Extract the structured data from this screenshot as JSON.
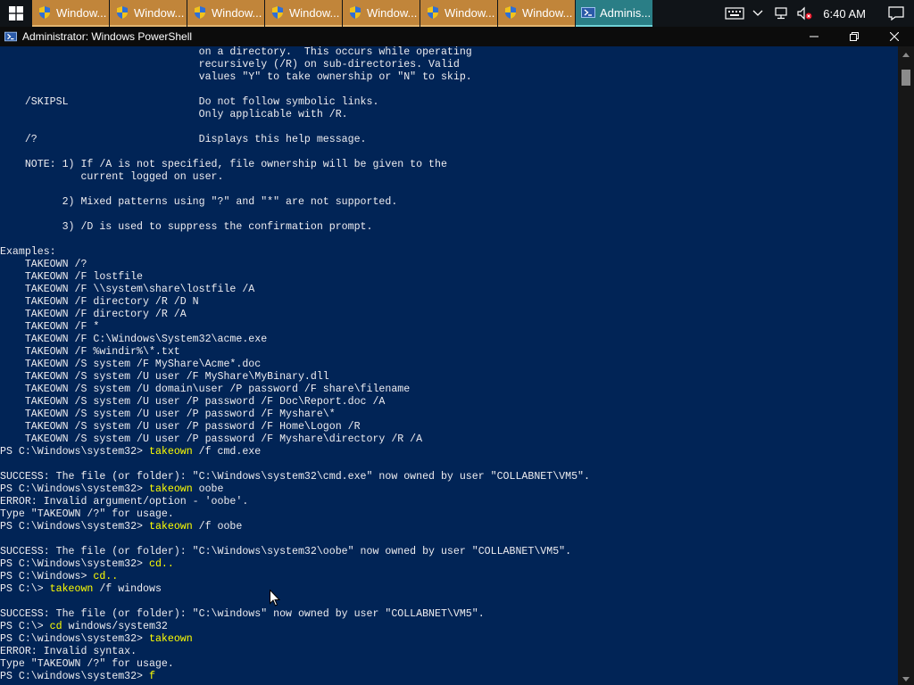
{
  "taskbar": {
    "tasks": [
      {
        "label": "Window..."
      },
      {
        "label": "Window..."
      },
      {
        "label": "Window..."
      },
      {
        "label": "Window..."
      },
      {
        "label": "Window..."
      },
      {
        "label": "Window..."
      },
      {
        "label": "Window..."
      },
      {
        "label": "Adminis..."
      }
    ],
    "clock": "6:40 AM",
    "colors": {
      "task_bg": "#c1853a",
      "active_task_bg": "#2a7e86",
      "taskbar_bg": "#101418"
    }
  },
  "window": {
    "title": "Administrator: Windows PowerShell",
    "colors": {
      "console_bg": "#012456",
      "text": "#eeedf0",
      "command": "#ffff00"
    }
  },
  "console": {
    "lines": [
      {
        "text": "                                on a directory.  This occurs while operating"
      },
      {
        "text": "                                recursively (/R) on sub-directories. Valid"
      },
      {
        "text": "                                values \"Y\" to take ownership or \"N\" to skip."
      },
      {
        "text": ""
      },
      {
        "text": "    /SKIPSL                     Do not follow symbolic links."
      },
      {
        "text": "                                Only applicable with /R."
      },
      {
        "text": ""
      },
      {
        "text": "    /?                          Displays this help message."
      },
      {
        "text": ""
      },
      {
        "text": "    NOTE: 1) If /A is not specified, file ownership will be given to the"
      },
      {
        "text": "             current logged on user."
      },
      {
        "text": ""
      },
      {
        "text": "          2) Mixed patterns using \"?\" and \"*\" are not supported."
      },
      {
        "text": ""
      },
      {
        "text": "          3) /D is used to suppress the confirmation prompt."
      },
      {
        "text": ""
      },
      {
        "text": "Examples:"
      },
      {
        "text": "    TAKEOWN /?"
      },
      {
        "text": "    TAKEOWN /F lostfile"
      },
      {
        "text": "    TAKEOWN /F \\\\system\\share\\lostfile /A"
      },
      {
        "text": "    TAKEOWN /F directory /R /D N"
      },
      {
        "text": "    TAKEOWN /F directory /R /A"
      },
      {
        "text": "    TAKEOWN /F *"
      },
      {
        "text": "    TAKEOWN /F C:\\Windows\\System32\\acme.exe"
      },
      {
        "text": "    TAKEOWN /F %windir%\\*.txt"
      },
      {
        "text": "    TAKEOWN /S system /F MyShare\\Acme*.doc"
      },
      {
        "text": "    TAKEOWN /S system /U user /F MyShare\\MyBinary.dll"
      },
      {
        "text": "    TAKEOWN /S system /U domain\\user /P password /F share\\filename"
      },
      {
        "text": "    TAKEOWN /S system /U user /P password /F Doc\\Report.doc /A"
      },
      {
        "text": "    TAKEOWN /S system /U user /P password /F Myshare\\*"
      },
      {
        "text": "    TAKEOWN /S system /U user /P password /F Home\\Logon /R"
      },
      {
        "text": "    TAKEOWN /S system /U user /P password /F Myshare\\directory /R /A"
      },
      {
        "prompt": "PS C:\\Windows\\system32> ",
        "cmd": "takeown",
        "args": " /f cmd.exe"
      },
      {
        "text": ""
      },
      {
        "text": "SUCCESS: The file (or folder): \"C:\\Windows\\system32\\cmd.exe\" now owned by user \"COLLABNET\\VM5\"."
      },
      {
        "prompt": "PS C:\\Windows\\system32> ",
        "cmd": "takeown",
        "args": " oobe"
      },
      {
        "text": "ERROR: Invalid argument/option - 'oobe'."
      },
      {
        "text": "Type \"TAKEOWN /?\" for usage."
      },
      {
        "prompt": "PS C:\\Windows\\system32> ",
        "cmd": "takeown",
        "args": " /f oobe"
      },
      {
        "text": ""
      },
      {
        "text": "SUCCESS: The file (or folder): \"C:\\Windows\\system32\\oobe\" now owned by user \"COLLABNET\\VM5\"."
      },
      {
        "prompt": "PS C:\\Windows\\system32> ",
        "cmd": "cd..",
        "args": ""
      },
      {
        "prompt": "PS C:\\Windows> ",
        "cmd": "cd..",
        "args": ""
      },
      {
        "prompt": "PS C:\\> ",
        "cmd": "takeown",
        "args": " /f windows"
      },
      {
        "text": ""
      },
      {
        "text": "SUCCESS: The file (or folder): \"C:\\windows\" now owned by user \"COLLABNET\\VM5\"."
      },
      {
        "prompt": "PS C:\\> ",
        "cmd": "cd",
        "args": " windows/system32"
      },
      {
        "prompt": "PS C:\\windows\\system32> ",
        "cmd": "takeown",
        "args": ""
      },
      {
        "text": "ERROR: Invalid syntax."
      },
      {
        "text": "Type \"TAKEOWN /?\" for usage."
      },
      {
        "prompt": "PS C:\\windows\\system32> ",
        "cmd": "f",
        "args": ""
      }
    ]
  }
}
